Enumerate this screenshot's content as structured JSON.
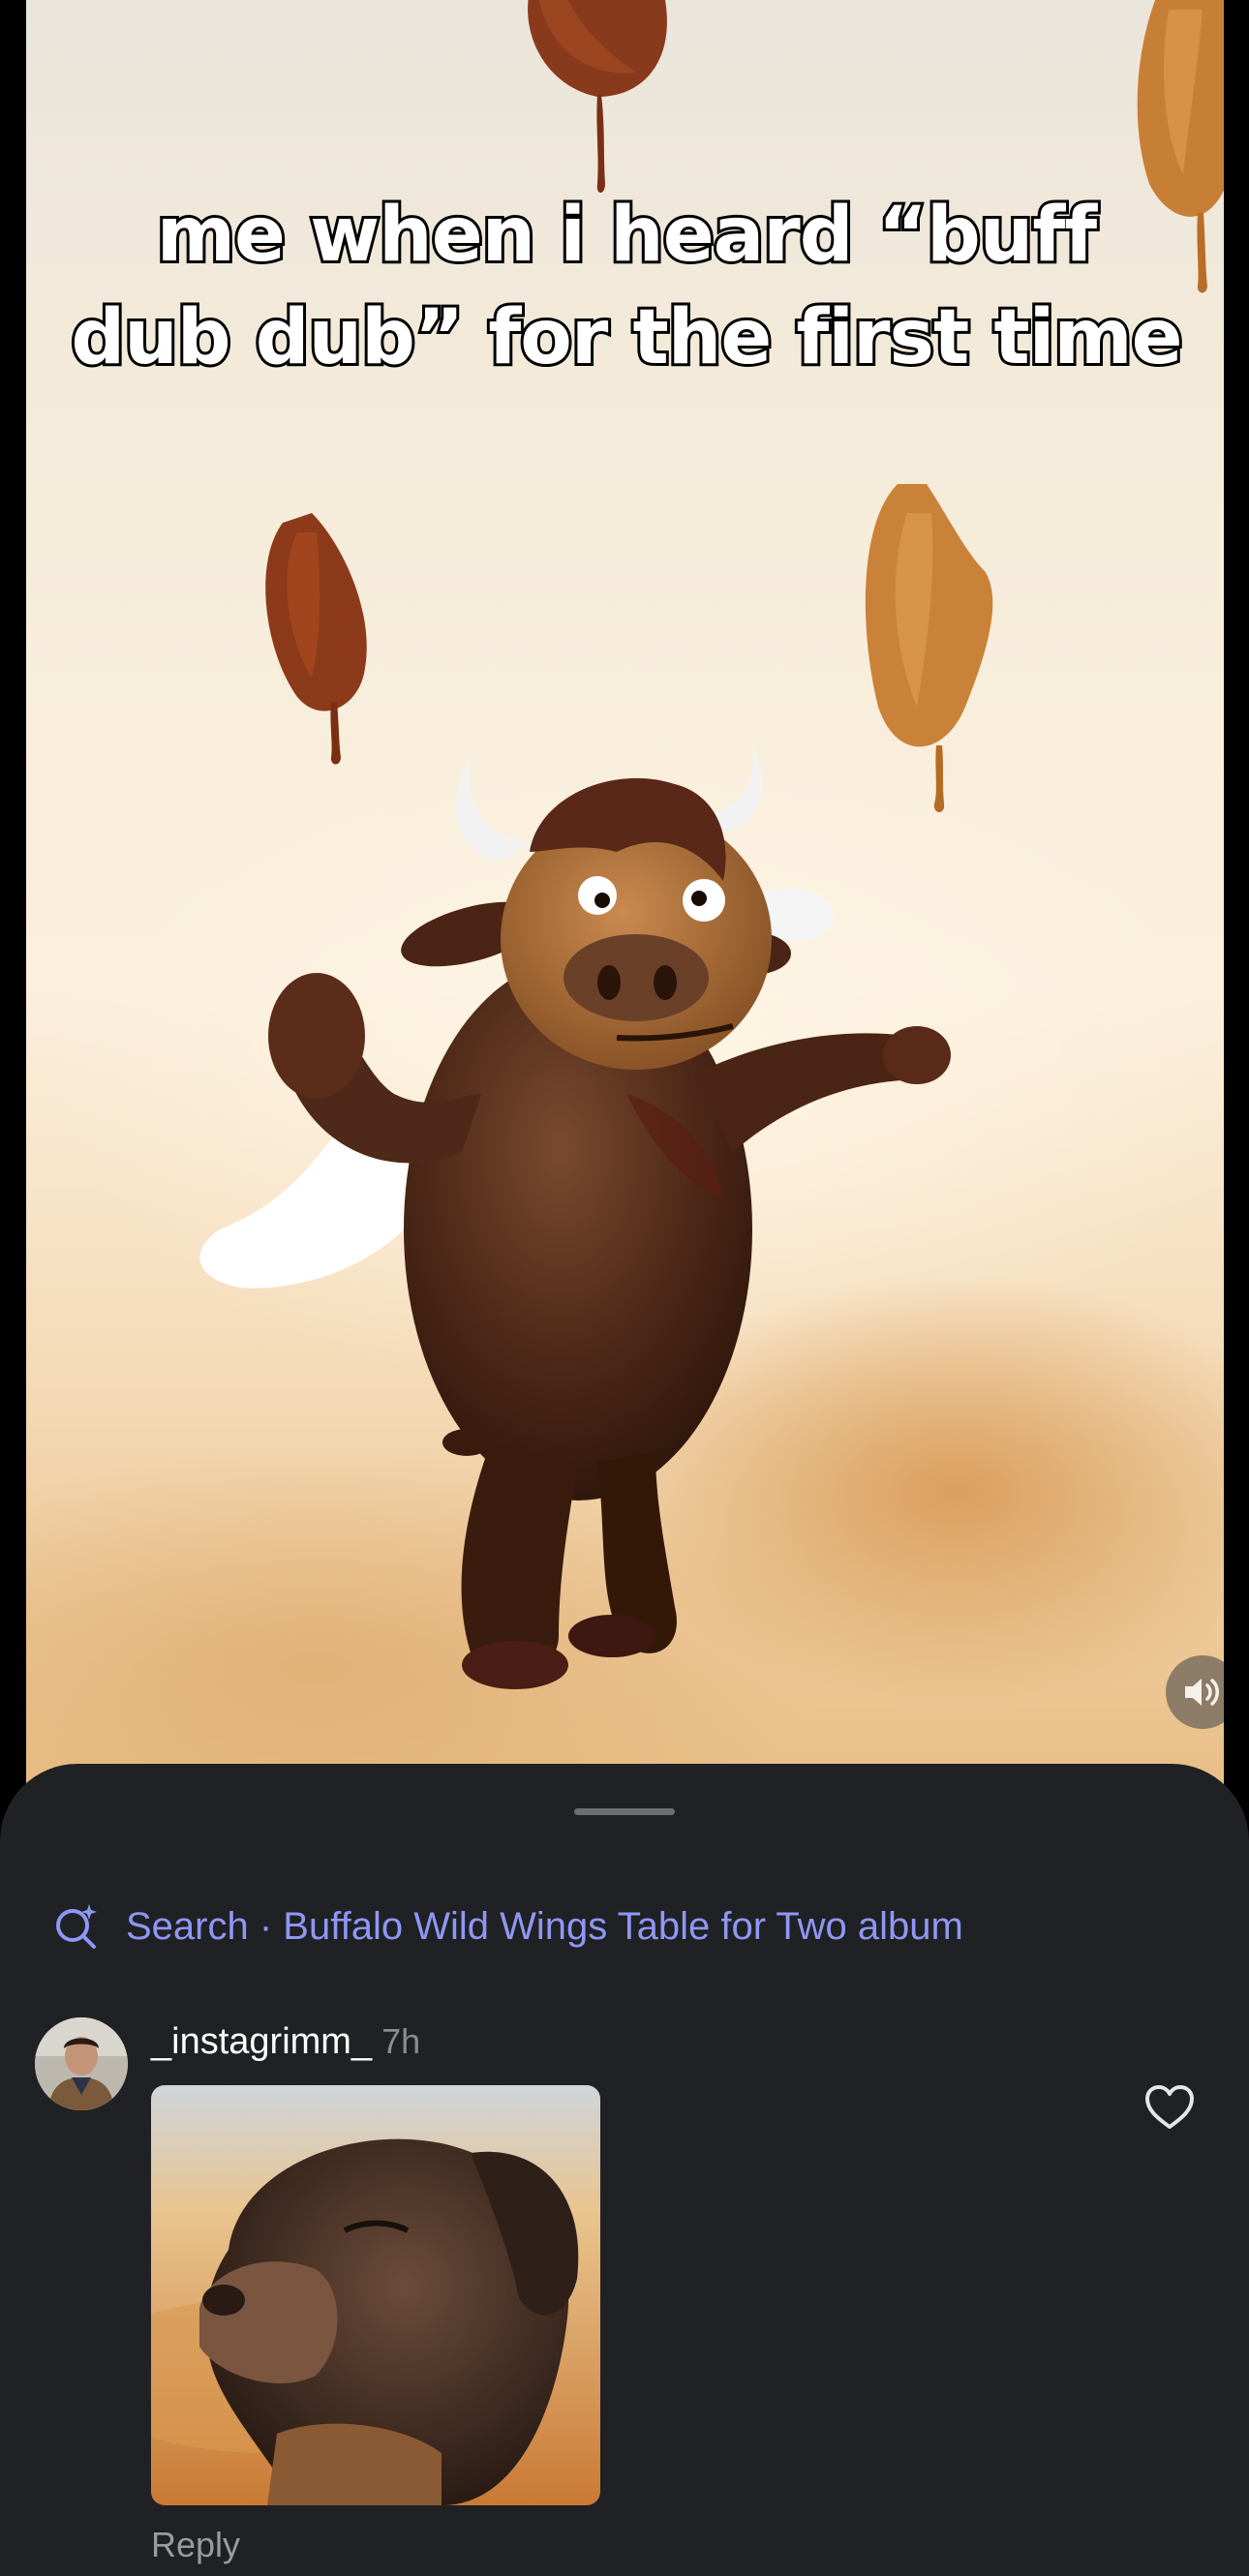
{
  "video": {
    "caption": "me when i heard “buff dub dub” for the first time",
    "sound_icon": "speaker-icon"
  },
  "comments_sheet": {
    "search": {
      "icon": "search-sparkle-icon",
      "label": "Search · Buffalo Wild Wings Table for Two album"
    },
    "comment": {
      "username": "_instagrimm_",
      "timestamp": "7h",
      "reply_label": "Reply",
      "like_icon": "heart-icon"
    }
  },
  "colors": {
    "sheet_bg": "#202124",
    "search_accent": "#8f97f5",
    "secondary_text": "#8b8c90"
  }
}
